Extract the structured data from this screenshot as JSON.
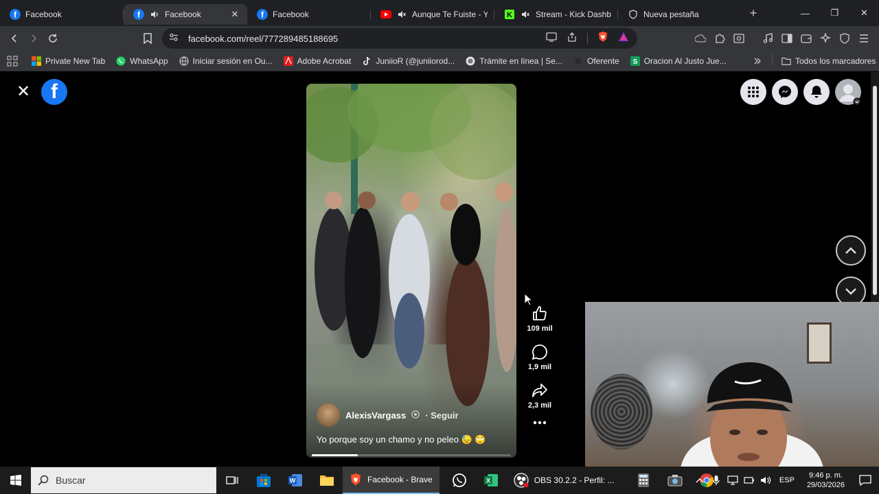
{
  "browser": {
    "tabs": [
      {
        "label": "Facebook",
        "favicon": "facebook-icon"
      },
      {
        "label": "Facebook",
        "favicon": "facebook-icon",
        "active": true,
        "audio": true
      },
      {
        "label": "Facebook",
        "favicon": "facebook-icon"
      },
      {
        "label": "Aunque Te Fuiste - You",
        "favicon": "youtube-icon",
        "muted": true
      },
      {
        "label": "Stream - Kick Dashboar",
        "favicon": "kick-icon",
        "muted": true
      },
      {
        "label": "Nueva pestaña",
        "favicon": "brave-shield-icon"
      }
    ],
    "url": "facebook.com/reel/777289485188695",
    "bookmarks": [
      {
        "label": "Private New Tab",
        "icon": "windows-icon"
      },
      {
        "label": "WhatsApp",
        "icon": "whatsapp-icon"
      },
      {
        "label": "Iniciar sesión en Ou...",
        "icon": "globe-icon"
      },
      {
        "label": "Adobe Acrobat",
        "icon": "acrobat-icon"
      },
      {
        "label": "JuniioR (@juniiorod...",
        "icon": "tiktok-icon"
      },
      {
        "label": "Trámite en línea | Se...",
        "icon": "seal-icon"
      },
      {
        "label": "Oferente",
        "icon": "dot-icon"
      },
      {
        "label": "Oracion Al Justo Jue...",
        "icon": "s-icon"
      }
    ],
    "all_bookmarks": "Todos los marcadores"
  },
  "reel": {
    "author": "AlexisVargass",
    "follow": "· Seguir",
    "caption": "Yo porque soy un chamo y no peleo 😓 🙄",
    "progress": 0.23,
    "likes": "109 mil",
    "comments": "1,9 mil",
    "shares": "2,3 mil"
  },
  "taskbar": {
    "search_placeholder": "Buscar",
    "brave_label": "Facebook - Brave",
    "obs_label": "OBS 30.2.2 - Perfil: ...",
    "language": "ESP",
    "time": "9:46 p. m.",
    "date": "29/03/2026"
  },
  "colors": {
    "facebook_blue": "#1877f2",
    "tab_bar": "#1f2023",
    "toolbar": "#35363a"
  }
}
